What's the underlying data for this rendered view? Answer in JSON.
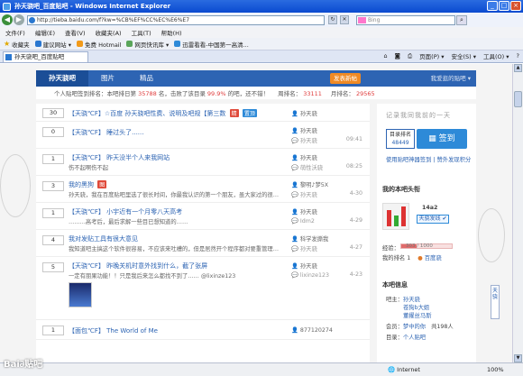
{
  "window": {
    "title": "孙天骁吧_百度贴吧 - Windows Internet Explorer",
    "minimize_label": "_",
    "maximize_label": "□",
    "close_label": "×"
  },
  "address": {
    "url": "http://tieba.baidu.com/f?kw=%CB%EF%CC%EC%E6%E7",
    "search_placeholder": "Bing"
  },
  "menu": [
    "文件(F)",
    "编辑(E)",
    "查看(V)",
    "收藏夹(A)",
    "工具(T)",
    "帮助(H)"
  ],
  "favorites": {
    "label": "收藏夹",
    "items": [
      "建议网站 ▾",
      "免费 Hotmail",
      "网页快讯库 ▾",
      "迅雷看看-中国第一高清..."
    ]
  },
  "tab": {
    "label": "孙天骁吧_百度贴吧"
  },
  "commandbar": [
    "页面(P) ▾",
    "安全(S) ▾",
    "工具(O) ▾",
    "?"
  ],
  "forum_nav": {
    "tabs": [
      "孙天骁吧",
      "图片",
      "精品"
    ],
    "post_label": "发表新帖",
    "jump_label": "我爱逛的贴吧 ▾"
  },
  "stats": {
    "member_prefix": "个人贴吧签到排名：本吧排日第",
    "member_num": "35788",
    "member_suffix": "名，击败了该目录",
    "percent": "99.9%",
    "percent_suffix": "的吧，还不错！",
    "week_label": "周排名：",
    "week_num": "33111",
    "month_label": "月排名：",
    "month_num": "29565"
  },
  "threads": [
    {
      "replies": "30",
      "title": "【天骁℃F】☆百度 孙天骁吧性费、说明及吧规【第三数",
      "badges": [
        "精",
        "置顶"
      ],
      "author": "孙天骁",
      "last": "",
      "time": "",
      "snippet": ""
    },
    {
      "replies": "0",
      "title": "【天骁℃F】 睡过头了......",
      "badges": [],
      "author": "孙天骁",
      "last": "孙天骁",
      "time": "09:41",
      "snippet": ""
    },
    {
      "replies": "1",
      "title": "【天骁℃F】 昨天没半个人来我网站",
      "badges": [],
      "author": "孙天骁",
      "last": "萌性沃骁",
      "time": "08:25",
      "snippet": "伤不起啊伤不起"
    },
    {
      "replies": "3",
      "title": "我的黑狗",
      "badges": [
        "图"
      ],
      "author": "黎明♪梦5X",
      "last": "孙天骁",
      "time": "4-30",
      "snippet": "孙天骁，我在百度贴吧里选了很长时间，你最我认识的第一个朋友，虽大家过的很…"
    },
    {
      "replies": "1",
      "title": "【天骁℃F】 小宇近有一个月零八天高考",
      "badges": [],
      "author": "孙天骁",
      "last": "Idm2",
      "time": "4-29",
      "snippet": "………高考后，最后求解一些目已想知道的……"
    },
    {
      "replies": "4",
      "title": "我对发贴工具有很大意见",
      "badges": [],
      "author": "科学发撕我",
      "last": "孙天骁",
      "time": "4-27",
      "snippet": "我知道吧主搞这个软件很容易，不应该来吐槽的，但是居然开个程序都对要重管理…"
    },
    {
      "replies": "5",
      "title": "【天骁℃F】 昨晚关机时意外找到什么，截了张屏",
      "badges": [],
      "author": "孙天骁",
      "last": "lixinze123",
      "time": "4-23",
      "snippet": "一定有朋果功能！！只是我后来怎么都找不到了……",
      "snippet2": "@lixinze123"
    },
    {
      "replies": "1",
      "title": "【面包℃F】 The World of Me",
      "badges": [],
      "author": "877120274",
      "last": "",
      "time": "",
      "snippet": ""
    }
  ],
  "sidebar": {
    "slogan": "记录我同我前的一天",
    "sign_rank_label": "目录排名",
    "sign_rank_num": "48449",
    "sign_button": "签到",
    "sign_links": "使用贴吧神器签到 | 赞外发现积分",
    "my_header": "我的本吧头衔",
    "level_num": "14a2",
    "follow_label": "天骁发线 ✔",
    "exp_label": "经验：",
    "exp_value": "303 / 1000",
    "exp_fraction": 0.3,
    "member_rank": "我的排名 1",
    "hundred": "百度骁",
    "forum_info": "本吧信息",
    "admins_label": "吧主：",
    "admins": [
      "孙天骁",
      "苍狗b大姐",
      "董擢丝马斯"
    ],
    "members_label": "会员：",
    "members_value": "梦中的你",
    "members_total": "共198人",
    "dir_label": "目录：",
    "dir_value": "个人贴吧",
    "side_tag": "天骁"
  },
  "statusbar": {
    "logo": "Bai∂贴吧",
    "zone": "Internet",
    "zoom": "100%"
  }
}
